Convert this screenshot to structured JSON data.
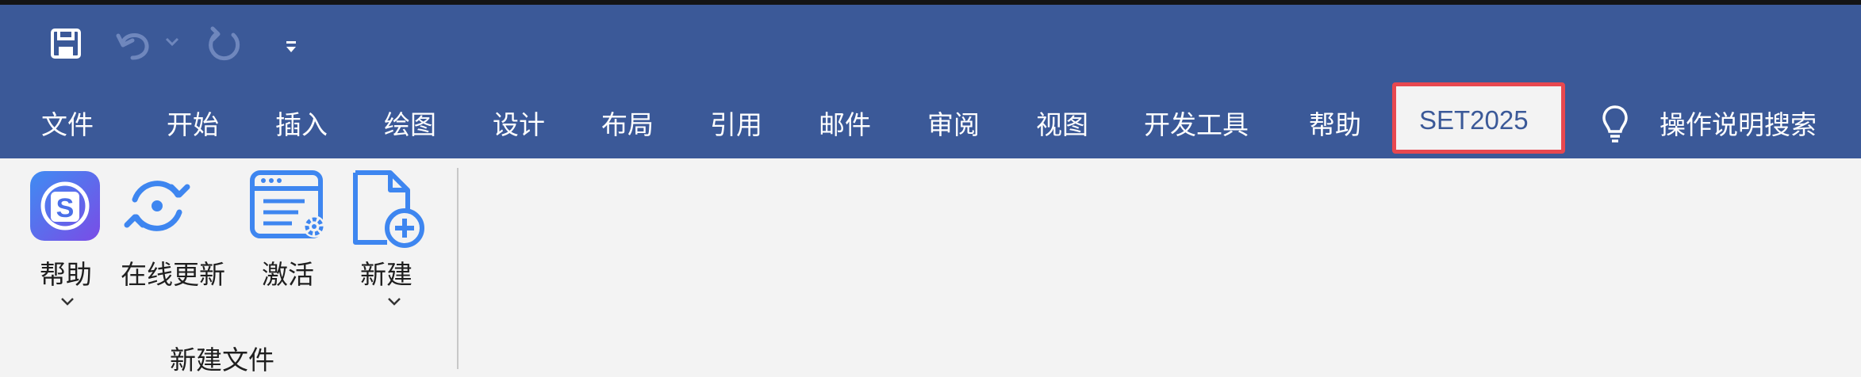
{
  "quick_access": {
    "icons": [
      "save-icon",
      "undo-icon",
      "undo-dropdown-icon",
      "redo-icon",
      "customize-qa-icon"
    ]
  },
  "tabs": [
    {
      "label": "文件"
    },
    {
      "label": "开始"
    },
    {
      "label": "插入"
    },
    {
      "label": "绘图"
    },
    {
      "label": "设计"
    },
    {
      "label": "布局"
    },
    {
      "label": "引用"
    },
    {
      "label": "邮件"
    },
    {
      "label": "审阅"
    },
    {
      "label": "视图"
    },
    {
      "label": "开发工具"
    },
    {
      "label": "帮助"
    },
    {
      "label": "SET2025",
      "active": true
    }
  ],
  "search": {
    "icon": "lightbulb-icon",
    "label": "操作说明搜索"
  },
  "ribbon": {
    "group": {
      "label": "新建文件",
      "buttons": [
        {
          "label": "帮助",
          "icon": "help-s-icon",
          "dropdown": true
        },
        {
          "label": "在线更新",
          "icon": "online-update-icon",
          "dropdown": false
        },
        {
          "label": "激活",
          "icon": "activate-icon",
          "dropdown": false
        },
        {
          "label": "新建",
          "icon": "new-file-icon",
          "dropdown": true
        }
      ]
    }
  },
  "colors": {
    "accent": "#3b5998",
    "highlight_border": "#e8484f",
    "ribbon_bg": "#f3f3f3",
    "icon_blue": "#3e86f0"
  }
}
